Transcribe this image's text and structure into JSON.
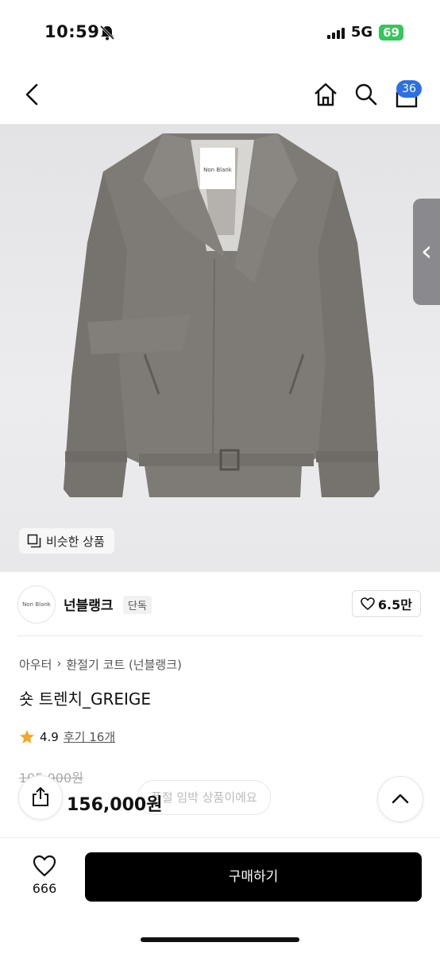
{
  "status_bar": {
    "time": "10:59",
    "network": "5G",
    "battery": "69"
  },
  "header": {
    "cart_count": "36"
  },
  "product_image": {
    "label_on_tag": "Non Blank"
  },
  "similar_button": {
    "label": "비슷한 상품"
  },
  "brand": {
    "logo_text": "Non Blank",
    "name": "넌블랭크",
    "badge": "단독",
    "likes": "6.5만"
  },
  "breadcrumb": {
    "level1": "아우터",
    "level2": "환절기 코트 (넌블랭크)"
  },
  "product": {
    "title": "숏 트렌치_GREIGE",
    "rating": "4.9",
    "review_link": "후기 16개",
    "original_price": "195,000원",
    "price": "156,000원",
    "soldout_notice": "품절 임박 상품이에요"
  },
  "bottom_bar": {
    "wishlist_count": "666",
    "buy_label": "구매하기"
  },
  "colors": {
    "accent_blue": "#2e6fe8",
    "star": "#f5a623",
    "battery_green": "#34c759"
  }
}
